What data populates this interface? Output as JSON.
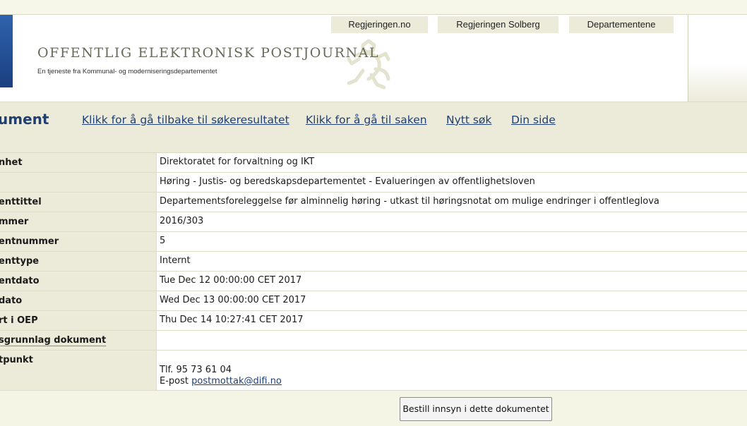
{
  "header": {
    "tabs": [
      {
        "label": "Regjeringen.no"
      },
      {
        "label": "Regjeringen Solberg"
      },
      {
        "label": "Departementene"
      }
    ],
    "title": "OFFENTLIG ELEKTRONISK POSTJOURNAL",
    "subtitle": "En tjeneste fra Kommunal- og moderniseringsdepartementet",
    "logo_icon": "lion-coat-of-arms-icon"
  },
  "nav": {
    "title": "ument",
    "links": [
      {
        "label": "Klikk for å gå tilbake til søkeresultatet"
      },
      {
        "label": "Klikk for å gå til saken"
      },
      {
        "label": "Nytt søk"
      },
      {
        "label": "Din side"
      }
    ]
  },
  "rows": [
    {
      "label": "nhet",
      "value": "Direktoratet for forvaltning og IKT"
    },
    {
      "label": "",
      "value": "Høring - Justis- og beredskapsdepartementet - Evalueringen av offentlighetsloven"
    },
    {
      "label": "enttittel",
      "value": "Departementsforeleggelse før alminnelig høring - utkast til høringsnotat om mulige endringer i offentleglova"
    },
    {
      "label": "mmer",
      "value": "2016/303"
    },
    {
      "label": "entnummer",
      "value": "5"
    },
    {
      "label": "enttype",
      "value": "Internt"
    },
    {
      "label": "entdato",
      "value": "Tue Dec 12 00:00:00 CET 2017"
    },
    {
      "label": "dato",
      "value": "Wed Dec 13 00:00:00 CET 2017"
    },
    {
      "label": "rt i OEP",
      "value": "Thu Dec 14 10:27:41 CET 2017"
    },
    {
      "label": "sgrunnlag dokument",
      "value": ""
    }
  ],
  "contact": {
    "label": "tpunkt",
    "phone": "Tlf. 95 73 61 04",
    "email_prefix": "E-post",
    "email": "postmottak@difi.no"
  },
  "actions": {
    "order_button": "Bestill innsyn i dette dokumentet"
  },
  "colors": {
    "background": "#f5f5e6",
    "label_bg": "#ecebd9",
    "link": "#1f3f74",
    "accent_blue": "#2f63ad"
  }
}
